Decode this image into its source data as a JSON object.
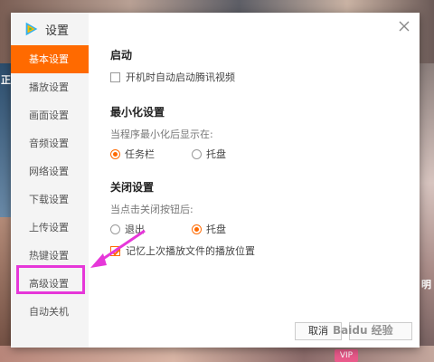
{
  "window": {
    "title": "设置"
  },
  "sidebar": {
    "items": [
      {
        "label": "基本设置",
        "active": true
      },
      {
        "label": "播放设置"
      },
      {
        "label": "画面设置"
      },
      {
        "label": "音频设置"
      },
      {
        "label": "网络设置"
      },
      {
        "label": "下载设置"
      },
      {
        "label": "上传设置"
      },
      {
        "label": "热键设置"
      },
      {
        "label": "高级设置",
        "highlighted": true
      },
      {
        "label": "自动关机"
      }
    ]
  },
  "startup": {
    "title": "启动",
    "auto_start_label": "开机时自动启动腾讯视频",
    "auto_start_checked": false
  },
  "minimize": {
    "title": "最小化设置",
    "hint": "当程序最小化后显示在:",
    "options": [
      "任务栏",
      "托盘"
    ],
    "selected": "任务栏"
  },
  "close": {
    "title": "关闭设置",
    "hint": "当点击关闭按钮后:",
    "options": [
      "退出",
      "托盘"
    ],
    "selected": "托盘",
    "remember_label": "记忆上次播放文件的播放位置",
    "remember_checked": true
  },
  "footer": {
    "cancel_label": "取消"
  },
  "watermark": "Baidu 经验",
  "background": {
    "vip_badge": "VIP",
    "side_text_left": "正",
    "side_text_right": "明"
  },
  "colors": {
    "accent": "#ff6a00",
    "annotation": "#e637d9"
  }
}
